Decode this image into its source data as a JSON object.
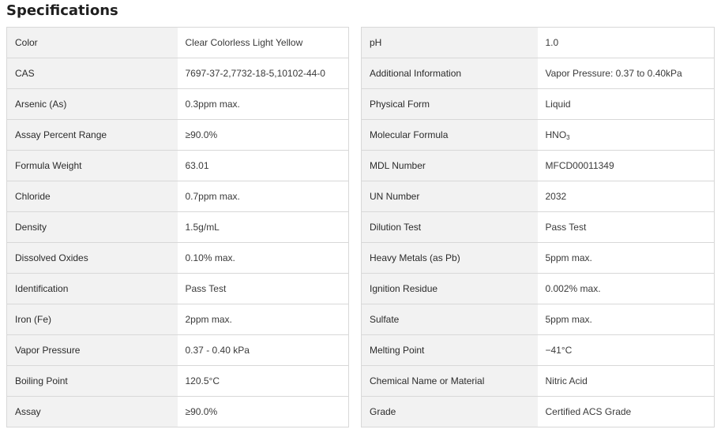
{
  "title": "Specifications",
  "left_rows": [
    {
      "key": "Color",
      "value": "Clear Colorless Light Yellow"
    },
    {
      "key": "CAS",
      "value": "7697-37-2,7732-18-5,10102-44-0"
    },
    {
      "key": "Arsenic (As)",
      "value": "0.3ppm max."
    },
    {
      "key": "Assay Percent Range",
      "value": "≥90.0%"
    },
    {
      "key": "Formula Weight",
      "value": "63.01"
    },
    {
      "key": "Chloride",
      "value": "0.7ppm max."
    },
    {
      "key": "Density",
      "value": "1.5g/mL"
    },
    {
      "key": "Dissolved Oxides",
      "value": "0.10% max."
    },
    {
      "key": "Identification",
      "value": "Pass Test"
    },
    {
      "key": "Iron (Fe)",
      "value": "2ppm max."
    },
    {
      "key": "Vapor Pressure",
      "value": "0.37 - 0.40 kPa"
    },
    {
      "key": "Boiling Point",
      "value": "120.5°C"
    },
    {
      "key": "Assay",
      "value": "≥90.0%"
    }
  ],
  "right_rows": [
    {
      "key": "pH",
      "value": "1.0"
    },
    {
      "key": "Additional Information",
      "value": "Vapor Pressure: 0.37 to 0.40kPa"
    },
    {
      "key": "Physical Form",
      "value": "Liquid"
    },
    {
      "key": "Molecular Formula",
      "value": "HNO",
      "value_sub": "3"
    },
    {
      "key": "MDL Number",
      "value": "MFCD00011349"
    },
    {
      "key": "UN Number",
      "value": "2032"
    },
    {
      "key": "Dilution Test",
      "value": "Pass Test"
    },
    {
      "key": "Heavy Metals (as Pb)",
      "value": "5ppm max."
    },
    {
      "key": "Ignition Residue",
      "value": "0.002% max."
    },
    {
      "key": "Sulfate",
      "value": "5ppm max."
    },
    {
      "key": "Melting Point",
      "value": "−41°C"
    },
    {
      "key": "Chemical Name or Material",
      "value": "Nitric Acid"
    },
    {
      "key": "Grade",
      "value": "Certified ACS Grade"
    }
  ]
}
